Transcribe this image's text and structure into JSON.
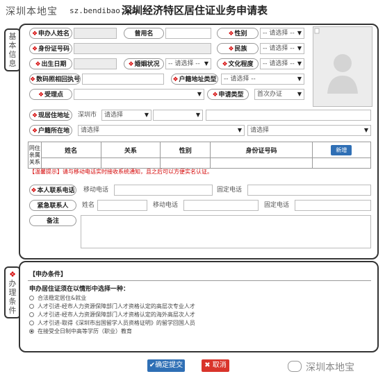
{
  "header": {
    "site_name": "深圳本地宝",
    "site_url": "sz.bendibao.com",
    "form_title": "深圳经济特区居住证业务申请表"
  },
  "section1": {
    "tab_label": "基本信息"
  },
  "section2": {
    "tab_label": "办理条件"
  },
  "fields": {
    "applicant_name": "申办人姓名",
    "used_name": "曾用名",
    "gender": "性别",
    "id_number": "身份证号码",
    "ethnicity": "民族",
    "birth_date": "出生日期",
    "marital_status": "婚姻状况",
    "education": "文化程度",
    "photo_receipt": "数码照相回执号",
    "hukou_type": "户籍地址类型",
    "accept_point": "受理点",
    "apply_type": "申请类型",
    "current_address": "现居住地址",
    "hukou_location": "户籍所在地",
    "contact_phone": "本人联系电话",
    "emergency_contact": "紧急联系人",
    "remarks": "备注"
  },
  "values": {
    "please_select": "请选择",
    "select_placeholder": "-- 请选择 --",
    "apply_type_value": "首次办证",
    "city": "深圳市",
    "mobile_label": "移动电话",
    "landline_label": "固定电话",
    "name_label": "姓名"
  },
  "family": {
    "side_label": [
      "同住",
      "亲属",
      "关系"
    ],
    "headers": [
      "姓名",
      "关系",
      "性别",
      "身份证号码"
    ],
    "add_button": "新增"
  },
  "notice": "【温馨提示】请与移动电话实时接收系统通知，且之后可以方便实名认证。",
  "conditions": {
    "title": "【申办条件】",
    "prompt": "申办居住证须在以情形中选择一种：",
    "options": [
      "合法稳定居住&就业",
      "人才引进-经市人力资源保障部门人才资格认定的高层次专业人才",
      "人才引进-经市人力资源保障部门人才资格认定的海外高层次人才",
      "人才引进-取得《深圳市出国留学人员资格证明》的留学回国人员",
      "在接受全日制中高等学历（职业）教育"
    ],
    "selected_index": 4
  },
  "buttons": {
    "submit": "确定提交",
    "cancel": "取消"
  },
  "watermark": "深圳本地宝",
  "colors": {
    "required": "#d40000",
    "submit": "#2f6fb5",
    "cancel": "#d9342b",
    "add": "#2f6fb5"
  }
}
